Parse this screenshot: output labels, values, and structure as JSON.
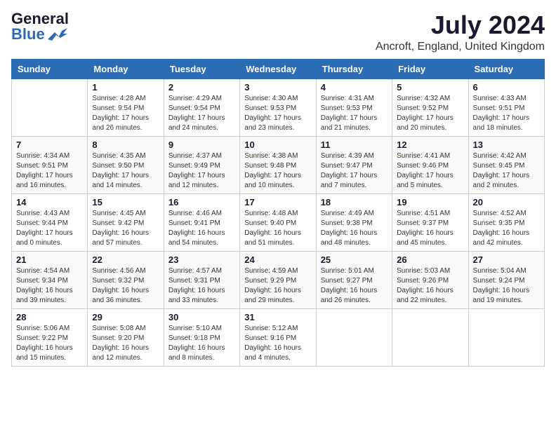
{
  "header": {
    "logo_general": "General",
    "logo_blue": "Blue",
    "month_title": "July 2024",
    "location": "Ancroft, England, United Kingdom"
  },
  "weekdays": [
    "Sunday",
    "Monday",
    "Tuesday",
    "Wednesday",
    "Thursday",
    "Friday",
    "Saturday"
  ],
  "weeks": [
    [
      {
        "day": "",
        "info": ""
      },
      {
        "day": "1",
        "info": "Sunrise: 4:28 AM\nSunset: 9:54 PM\nDaylight: 17 hours\nand 26 minutes."
      },
      {
        "day": "2",
        "info": "Sunrise: 4:29 AM\nSunset: 9:54 PM\nDaylight: 17 hours\nand 24 minutes."
      },
      {
        "day": "3",
        "info": "Sunrise: 4:30 AM\nSunset: 9:53 PM\nDaylight: 17 hours\nand 23 minutes."
      },
      {
        "day": "4",
        "info": "Sunrise: 4:31 AM\nSunset: 9:53 PM\nDaylight: 17 hours\nand 21 minutes."
      },
      {
        "day": "5",
        "info": "Sunrise: 4:32 AM\nSunset: 9:52 PM\nDaylight: 17 hours\nand 20 minutes."
      },
      {
        "day": "6",
        "info": "Sunrise: 4:33 AM\nSunset: 9:51 PM\nDaylight: 17 hours\nand 18 minutes."
      }
    ],
    [
      {
        "day": "7",
        "info": "Sunrise: 4:34 AM\nSunset: 9:51 PM\nDaylight: 17 hours\nand 16 minutes."
      },
      {
        "day": "8",
        "info": "Sunrise: 4:35 AM\nSunset: 9:50 PM\nDaylight: 17 hours\nand 14 minutes."
      },
      {
        "day": "9",
        "info": "Sunrise: 4:37 AM\nSunset: 9:49 PM\nDaylight: 17 hours\nand 12 minutes."
      },
      {
        "day": "10",
        "info": "Sunrise: 4:38 AM\nSunset: 9:48 PM\nDaylight: 17 hours\nand 10 minutes."
      },
      {
        "day": "11",
        "info": "Sunrise: 4:39 AM\nSunset: 9:47 PM\nDaylight: 17 hours\nand 7 minutes."
      },
      {
        "day": "12",
        "info": "Sunrise: 4:41 AM\nSunset: 9:46 PM\nDaylight: 17 hours\nand 5 minutes."
      },
      {
        "day": "13",
        "info": "Sunrise: 4:42 AM\nSunset: 9:45 PM\nDaylight: 17 hours\nand 2 minutes."
      }
    ],
    [
      {
        "day": "14",
        "info": "Sunrise: 4:43 AM\nSunset: 9:44 PM\nDaylight: 17 hours\nand 0 minutes."
      },
      {
        "day": "15",
        "info": "Sunrise: 4:45 AM\nSunset: 9:42 PM\nDaylight: 16 hours\nand 57 minutes."
      },
      {
        "day": "16",
        "info": "Sunrise: 4:46 AM\nSunset: 9:41 PM\nDaylight: 16 hours\nand 54 minutes."
      },
      {
        "day": "17",
        "info": "Sunrise: 4:48 AM\nSunset: 9:40 PM\nDaylight: 16 hours\nand 51 minutes."
      },
      {
        "day": "18",
        "info": "Sunrise: 4:49 AM\nSunset: 9:38 PM\nDaylight: 16 hours\nand 48 minutes."
      },
      {
        "day": "19",
        "info": "Sunrise: 4:51 AM\nSunset: 9:37 PM\nDaylight: 16 hours\nand 45 minutes."
      },
      {
        "day": "20",
        "info": "Sunrise: 4:52 AM\nSunset: 9:35 PM\nDaylight: 16 hours\nand 42 minutes."
      }
    ],
    [
      {
        "day": "21",
        "info": "Sunrise: 4:54 AM\nSunset: 9:34 PM\nDaylight: 16 hours\nand 39 minutes."
      },
      {
        "day": "22",
        "info": "Sunrise: 4:56 AM\nSunset: 9:32 PM\nDaylight: 16 hours\nand 36 minutes."
      },
      {
        "day": "23",
        "info": "Sunrise: 4:57 AM\nSunset: 9:31 PM\nDaylight: 16 hours\nand 33 minutes."
      },
      {
        "day": "24",
        "info": "Sunrise: 4:59 AM\nSunset: 9:29 PM\nDaylight: 16 hours\nand 29 minutes."
      },
      {
        "day": "25",
        "info": "Sunrise: 5:01 AM\nSunset: 9:27 PM\nDaylight: 16 hours\nand 26 minutes."
      },
      {
        "day": "26",
        "info": "Sunrise: 5:03 AM\nSunset: 9:26 PM\nDaylight: 16 hours\nand 22 minutes."
      },
      {
        "day": "27",
        "info": "Sunrise: 5:04 AM\nSunset: 9:24 PM\nDaylight: 16 hours\nand 19 minutes."
      }
    ],
    [
      {
        "day": "28",
        "info": "Sunrise: 5:06 AM\nSunset: 9:22 PM\nDaylight: 16 hours\nand 15 minutes."
      },
      {
        "day": "29",
        "info": "Sunrise: 5:08 AM\nSunset: 9:20 PM\nDaylight: 16 hours\nand 12 minutes."
      },
      {
        "day": "30",
        "info": "Sunrise: 5:10 AM\nSunset: 9:18 PM\nDaylight: 16 hours\nand 8 minutes."
      },
      {
        "day": "31",
        "info": "Sunrise: 5:12 AM\nSunset: 9:16 PM\nDaylight: 16 hours\nand 4 minutes."
      },
      {
        "day": "",
        "info": ""
      },
      {
        "day": "",
        "info": ""
      },
      {
        "day": "",
        "info": ""
      }
    ]
  ]
}
